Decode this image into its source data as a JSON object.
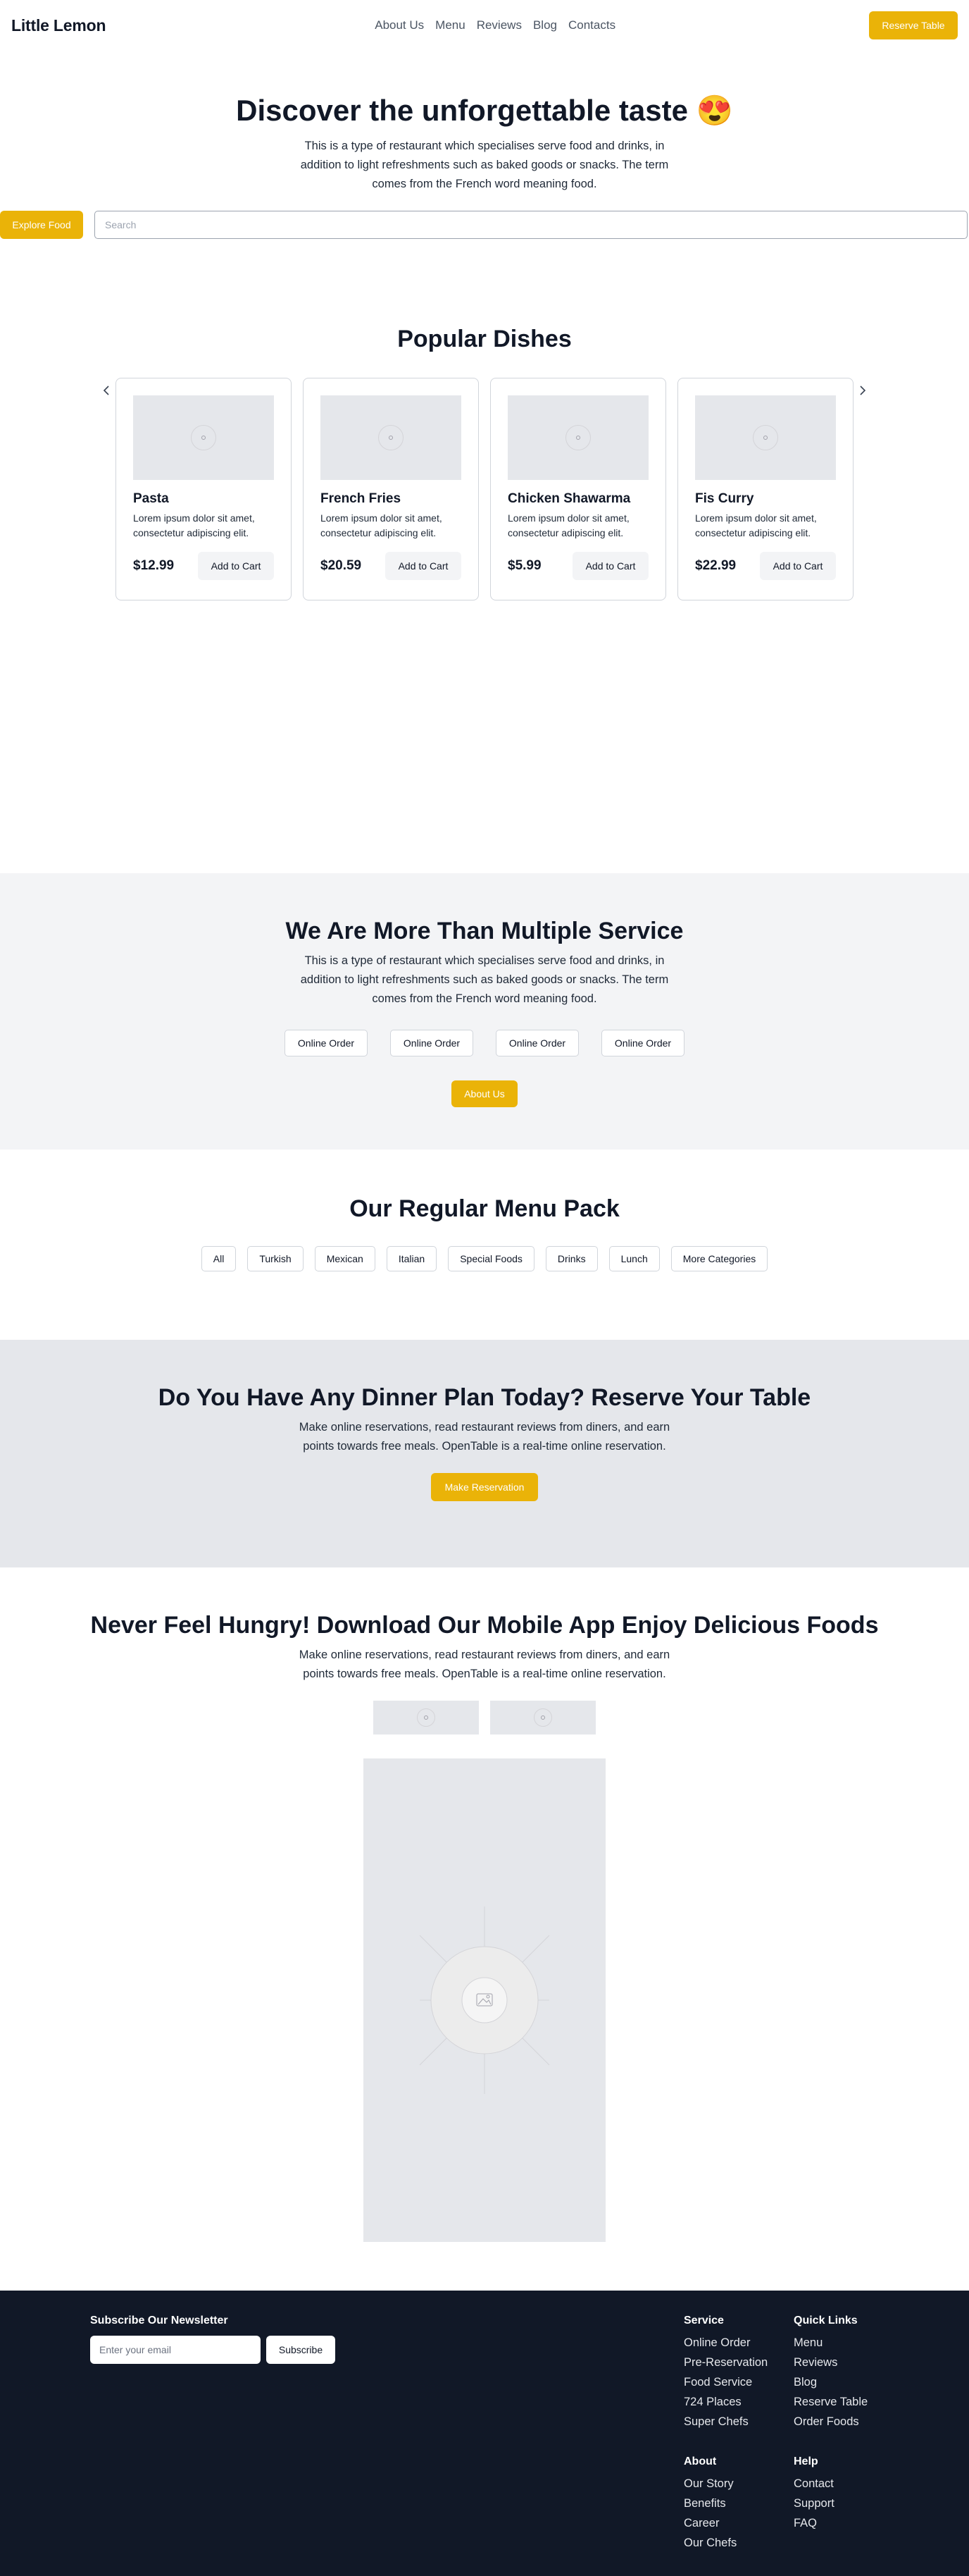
{
  "header": {
    "logo": "Little Lemon",
    "nav": [
      "About Us",
      "Menu",
      "Reviews",
      "Blog",
      "Contacts"
    ],
    "cta": "Reserve Table"
  },
  "hero": {
    "title": "Discover the unforgettable taste 😍",
    "description": "This is a type of restaurant which specialises serve food and drinks, in addition to light refreshments such as baked goods or snacks. The term comes from the French word meaning food.",
    "explore_label": "Explore Food",
    "search_placeholder": "Search"
  },
  "dishes": {
    "title": "Popular Dishes",
    "prev_icon": "chevron-left-icon",
    "next_icon": "chevron-right-icon",
    "items": [
      {
        "name": "Pasta",
        "description": "Lorem ipsum dolor sit amet, consectetur adipiscing elit.",
        "price": "$12.99",
        "cta": "Add to Cart"
      },
      {
        "name": "French Fries",
        "description": "Lorem ipsum dolor sit amet, consectetur adipiscing elit.",
        "price": "$20.59",
        "cta": "Add to Cart"
      },
      {
        "name": "Chicken Shawarma",
        "description": "Lorem ipsum dolor sit amet, consectetur adipiscing elit.",
        "price": "$5.99",
        "cta": "Add to Cart"
      },
      {
        "name": "Fis Curry",
        "description": "Lorem ipsum dolor sit amet, consectetur adipiscing elit.",
        "price": "$22.99",
        "cta": "Add to Cart"
      }
    ]
  },
  "service": {
    "title": "We Are More Than Multiple Service",
    "description": "This is a type of restaurant which specialises serve food and drinks, in addition to light refreshments such as baked goods or snacks. The term comes from the French word meaning food.",
    "options": [
      "Online Order",
      "Online Order",
      "Online Order",
      "Online Order"
    ],
    "cta": "About Us"
  },
  "menu_pack": {
    "title": "Our Regular Menu Pack",
    "categories": [
      "All",
      "Turkish",
      "Mexican",
      "Italian",
      "Special Foods",
      "Drinks",
      "Lunch",
      "More Categories"
    ]
  },
  "reservation": {
    "title": "Do You Have Any Dinner Plan Today? Reserve Your Table",
    "description": "Make online reservations, read restaurant reviews from diners, and earn points towards free meals. OpenTable is a real-time online reservation.",
    "cta": "Make Reservation"
  },
  "app": {
    "title": "Never Feel Hungry! Download Our Mobile App Enjoy Delicious Foods",
    "description": "Make online reservations, read restaurant reviews from diners, and earn points towards free meals. OpenTable is a real-time online reservation."
  },
  "footer": {
    "newsletter_title": "Subscribe Our Newsletter",
    "email_placeholder": "Enter your email",
    "subscribe_label": "Subscribe",
    "service": {
      "title": "Service",
      "links": [
        "Online Order",
        "Pre-Reservation",
        "Food Service",
        "724 Places",
        "Super Chefs"
      ]
    },
    "quick_links": {
      "title": "Quick Links",
      "links": [
        "Menu",
        "Reviews",
        "Blog",
        "Reserve Table",
        "Order Foods"
      ]
    },
    "about": {
      "title": "About",
      "links": [
        "Our Story",
        "Benefits",
        "Career",
        "Our Chefs"
      ]
    },
    "help": {
      "title": "Help",
      "links": [
        "Contact",
        "Support",
        "FAQ"
      ]
    }
  },
  "colors": {
    "accent": "#eab308",
    "footer_bg": "#111827",
    "section_gray": "#f3f4f6",
    "reserve_gray": "#e5e7eb"
  }
}
